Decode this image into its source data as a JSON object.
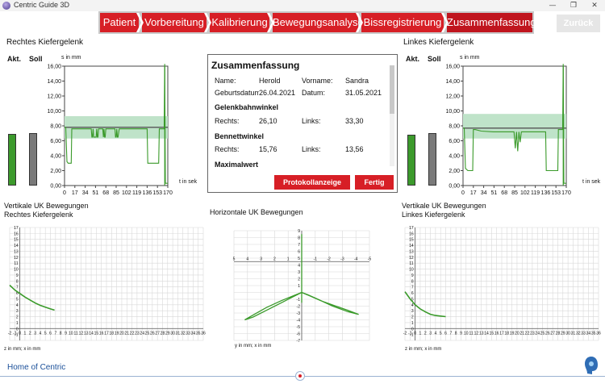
{
  "window": {
    "title": "Centric Guide 3D"
  },
  "nav": {
    "steps": [
      "Patient",
      "Vorbereitung",
      "Kalibrierung",
      "Bewegungsanalyse",
      "Bissregistrierung",
      "Zusammenfassung"
    ],
    "active": "Zusammenfassung",
    "back_label": "Zurück"
  },
  "left_panel": {
    "title": "Rechtes Kiefergelenk",
    "akt": "Akt.",
    "soll": "Soll",
    "y_unit": "s in mm",
    "x_unit": "t in sek",
    "y_ticks": [
      "16,00",
      "14,00",
      "12,00",
      "10,00",
      "8,00",
      "6,00",
      "4,00",
      "2,00",
      "0,00"
    ],
    "x_ticks": [
      "0",
      "17",
      "34",
      "51",
      "68",
      "85",
      "102",
      "119",
      "136",
      "153",
      "170"
    ]
  },
  "right_panel": {
    "title": "Linkes Kiefergelenk",
    "akt": "Akt.",
    "soll": "Soll",
    "y_unit": "s in mm",
    "x_unit": "t in sek",
    "y_ticks": [
      "16,00",
      "14,00",
      "12,00",
      "10,00",
      "8,00",
      "6,00",
      "4,00",
      "2,00",
      "0,00"
    ],
    "x_ticks": [
      "0",
      "17",
      "34",
      "51",
      "68",
      "85",
      "102",
      "119",
      "136",
      "153",
      "170"
    ]
  },
  "summary": {
    "title": "Zusammenfassung",
    "name_label": "Name:",
    "name": "Herold",
    "vorname_label": "Vorname:",
    "vorname": "Sandra",
    "geb_label": "Geburtsdatum:",
    "geb": "26.04.2021",
    "datum_label": "Datum:",
    "datum": "31.05.2021",
    "section1": "Gelenkbahnwinkel",
    "rechts_label": "Rechts:",
    "links_label": "Links:",
    "gbw_rechts": "26,10",
    "gbw_links": "33,30",
    "section2": "Bennettwinkel",
    "bw_rechts": "15,76",
    "bw_links": "13,56",
    "section3": "Maximalwert",
    "btn_protokoll": "Protokollanzeige",
    "btn_fertig": "Fertig"
  },
  "bottom": {
    "vert_right_title_1": "Vertikale UK Bewegungen",
    "vert_right_title_2": "Rechtes Kiefergelenk",
    "horiz_title": "Horizontale UK Bewegungen",
    "vert_left_title_1": "Vertikale UK Bewegungen",
    "vert_left_title_2": "Linkes Kiefergelenk",
    "vert_axis_label": "z in mm; x in mm",
    "horiz_axis_label": "y in mm; x in mm"
  },
  "footer": {
    "link": "Home of Centric"
  },
  "colors": {
    "accent": "#d71f26",
    "trace": "#3a9a2a",
    "band": "#bfe3c9"
  },
  "chart_data": [
    {
      "type": "line",
      "title": "Rechtes Kiefergelenk",
      "ylabel": "s in mm",
      "xlabel": "t in sek",
      "xlim": [
        0,
        170
      ],
      "ylim": [
        0,
        16
      ],
      "band": [
        6.3,
        9.3
      ],
      "reference": 7.8,
      "x": [
        0,
        2,
        4,
        6,
        8,
        10,
        11,
        12,
        14,
        16,
        17,
        18,
        20,
        30,
        40,
        44,
        45,
        46,
        47,
        48,
        52,
        53,
        54,
        55,
        56,
        60,
        63,
        64,
        65,
        66,
        67,
        68,
        69,
        72,
        75,
        80,
        83,
        84,
        85,
        86,
        87,
        88,
        90,
        95,
        100,
        110,
        120,
        130,
        136,
        137,
        140,
        150,
        153,
        155,
        156,
        157,
        160,
        164,
        165,
        166,
        170
      ],
      "values": [
        7.8,
        7.8,
        3.2,
        3.0,
        3.0,
        3.0,
        3.0,
        7.6,
        7.6,
        7.6,
        7.6,
        7.6,
        7.6,
        7.6,
        7.6,
        7.6,
        6.5,
        6.5,
        7.6,
        6.5,
        6.5,
        7.6,
        6.5,
        6.5,
        7.6,
        7.6,
        7.6,
        6.5,
        7.6,
        6.5,
        6.5,
        7.6,
        7.6,
        7.6,
        7.6,
        7.6,
        7.6,
        6.5,
        6.5,
        7.6,
        6.5,
        6.5,
        7.6,
        7.6,
        7.6,
        7.6,
        7.6,
        7.6,
        7.6,
        3.0,
        3.0,
        3.0,
        3.0,
        3.0,
        7.6,
        7.6,
        7.6,
        7.6,
        16.3,
        0.3,
        0.3
      ],
      "bars": {
        "akt": 6.9,
        "soll": 7.0
      }
    },
    {
      "type": "line",
      "title": "Linkes Kiefergelenk",
      "ylabel": "s in mm",
      "xlabel": "t in sek",
      "xlim": [
        0,
        170
      ],
      "ylim": [
        0,
        16
      ],
      "band": [
        6.3,
        9.6
      ],
      "reference": 7.7,
      "x": [
        0,
        2,
        4,
        8,
        12,
        14,
        16,
        17,
        20,
        30,
        50,
        60,
        70,
        80,
        84,
        86,
        88,
        90,
        92,
        94,
        96,
        100,
        110,
        120,
        130,
        136,
        137,
        140,
        150,
        153,
        156,
        157,
        160,
        164,
        165,
        166,
        170
      ],
      "values": [
        7.7,
        7.7,
        2.3,
        2.0,
        2.0,
        2.0,
        2.0,
        7.5,
        7.5,
        7.3,
        7.2,
        7.2,
        7.2,
        7.2,
        7.2,
        5.0,
        7.2,
        4.6,
        7.2,
        5.8,
        7.2,
        7.2,
        7.2,
        7.2,
        7.2,
        7.2,
        2.0,
        2.0,
        2.0,
        2.0,
        2.0,
        7.5,
        7.5,
        7.5,
        16.3,
        0.3,
        0.3
      ],
      "bars": {
        "akt": 6.8,
        "soll": 7.0
      }
    },
    {
      "type": "line",
      "title": "Vertikale UK Bewegungen Rechtes Kiefergelenk",
      "xlim": [
        -2,
        36
      ],
      "ylim": [
        -2,
        17
      ],
      "x_ticks": [
        -2,
        -1,
        0,
        1,
        2,
        3,
        4,
        5,
        6,
        7,
        8,
        9,
        10,
        11,
        12,
        13,
        14,
        15,
        16,
        17,
        18,
        19,
        20,
        21,
        22,
        23,
        24,
        25,
        26,
        27,
        28,
        29,
        30,
        31,
        32,
        33,
        34,
        35,
        36
      ],
      "y_ticks": [
        -1,
        0,
        1,
        2,
        3,
        4,
        5,
        6,
        7,
        8,
        9,
        10,
        11,
        12,
        13,
        14,
        15,
        16,
        17
      ],
      "x": [
        -2,
        -1,
        0,
        1,
        2,
        3,
        4,
        5,
        6,
        6.8
      ],
      "values": [
        7.3,
        6.5,
        5.9,
        5.3,
        4.8,
        4.3,
        3.9,
        3.6,
        3.3,
        3.1
      ]
    },
    {
      "type": "line",
      "title": "Horizontale UK Bewegungen",
      "xlim": [
        5,
        -5
      ],
      "ylim": [
        -7,
        9
      ],
      "x_ticks": [
        5,
        4,
        3,
        2,
        1,
        -1,
        -2,
        -3,
        -4,
        -5
      ],
      "y_ticks": [
        9,
        8,
        7,
        6,
        5,
        4,
        3,
        2,
        1,
        -1,
        -2,
        -3,
        -4,
        -5,
        -6,
        -7
      ],
      "series": [
        {
          "x": [
            0,
            0.5,
            1.5,
            2.6,
            3.5,
            4.2,
            3.6,
            2.5,
            1.5,
            0.6,
            0
          ],
          "values": [
            0,
            -0.4,
            -1.2,
            -2.2,
            -3.2,
            -4.0,
            -3.6,
            -2.5,
            -1.5,
            -0.6,
            0
          ]
        },
        {
          "x": [
            0,
            -0.6,
            -1.4,
            -2.4,
            -3.4,
            -4.2,
            -3.4,
            -2.3,
            -1.2,
            -0.4,
            0
          ],
          "values": [
            0,
            -0.5,
            -1.2,
            -1.9,
            -2.6,
            -3.2,
            -2.8,
            -2.0,
            -1.0,
            -0.3,
            0
          ]
        },
        {
          "x": [
            0,
            0,
            0,
            0
          ],
          "values": [
            0,
            8.5,
            -1.5,
            0
          ]
        }
      ]
    },
    {
      "type": "line",
      "title": "Vertikale UK Bewegungen Linkes Kiefergelenk",
      "xlim": [
        -2,
        36
      ],
      "ylim": [
        -2,
        17
      ],
      "x_ticks": [
        -2,
        -1,
        0,
        1,
        2,
        3,
        4,
        5,
        6,
        7,
        8,
        9,
        10,
        11,
        12,
        13,
        14,
        15,
        16,
        17,
        18,
        19,
        20,
        21,
        22,
        23,
        24,
        25,
        26,
        27,
        28,
        29,
        30,
        31,
        32,
        33,
        34,
        35,
        36
      ],
      "y_ticks": [
        -1,
        0,
        1,
        2,
        3,
        4,
        5,
        6,
        7,
        8,
        9,
        10,
        11,
        12,
        13,
        14,
        15,
        16,
        17
      ],
      "x": [
        -2,
        -1,
        0,
        1,
        2,
        3,
        4,
        5,
        6
      ],
      "values": [
        6.2,
        5.0,
        4.0,
        3.3,
        2.8,
        2.4,
        2.2,
        2.1,
        2.0
      ]
    }
  ]
}
